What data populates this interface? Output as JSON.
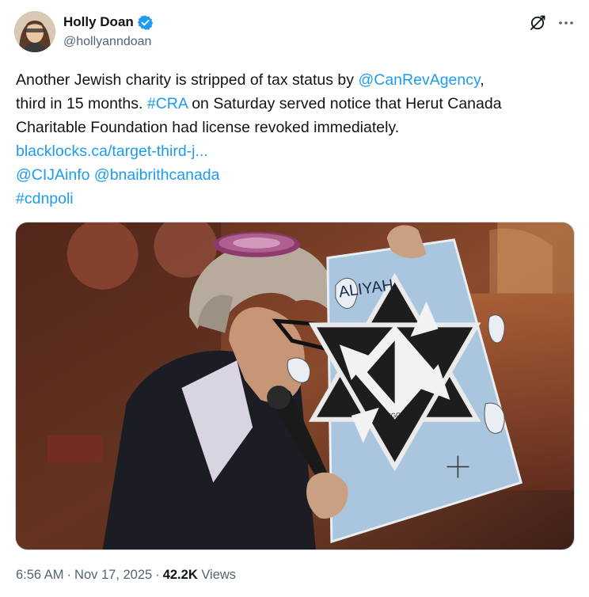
{
  "author": {
    "display_name": "Holly Doan",
    "handle": "@hollyanndoan",
    "verified": true
  },
  "tweet": {
    "segments": [
      [
        {
          "text": "Another Jewish charity is stripped of tax status by ",
          "link": false
        },
        {
          "text": "@CanRevAgency",
          "link": true
        },
        {
          "text": ",",
          "link": false
        }
      ],
      [
        {
          "text": "third in 15 months. ",
          "link": false
        },
        {
          "text": "#CRA",
          "link": true
        },
        {
          "text": " on Saturday served notice that Herut Canada",
          "link": false
        }
      ],
      [
        {
          "text": "Charitable Foundation had license revoked immediately.",
          "link": false
        }
      ],
      [
        {
          "text": "blacklocks.ca/target-third-j...",
          "link": true
        }
      ],
      [
        {
          "text": "@CIJAinfo",
          "link": true
        },
        {
          "text": " ",
          "link": false
        },
        {
          "text": "@bnaibrithcanada",
          "link": true
        }
      ],
      [
        {
          "text": "#cdnpoli",
          "link": true
        }
      ]
    ],
    "image_board_texts": {
      "board_title": "ALIYAH",
      "center_label": "CATEGORY"
    }
  },
  "meta": {
    "time": "6:56 AM",
    "date": "Nov 17, 2025",
    "views_count": "42.2K",
    "views_label": "Views",
    "separator": "·"
  },
  "icons": {
    "verified": "verified-badge-icon",
    "grok": "grok-icon",
    "more": "more-dots-icon"
  },
  "colors": {
    "link": "#1d9bf0",
    "secondary_text": "#536471",
    "verified": "#1d9bf0"
  }
}
